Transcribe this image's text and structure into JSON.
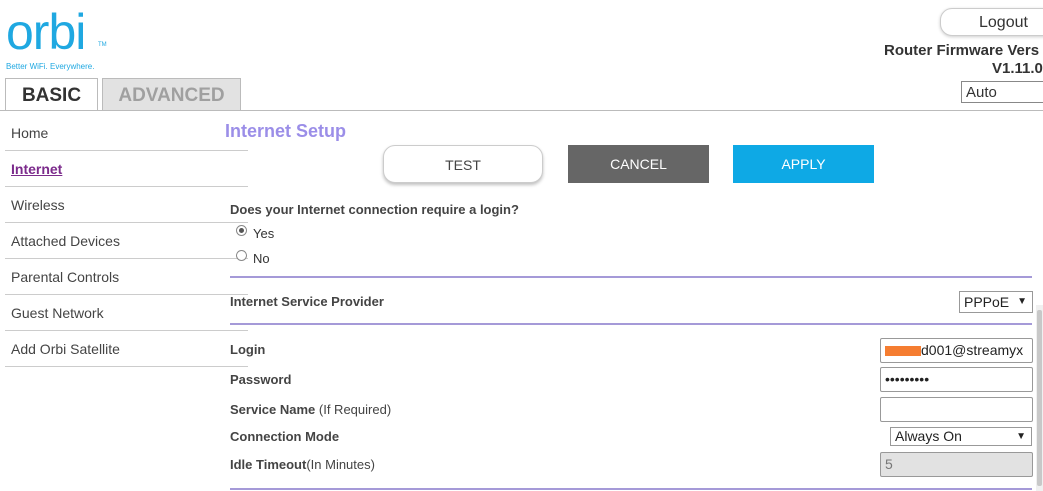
{
  "brand": {
    "logo_text": "orbi",
    "tm": "TM",
    "tagline": "Better WiFi. Everywhere."
  },
  "tabs": [
    {
      "label": "BASIC",
      "active": true
    },
    {
      "label": "ADVANCED",
      "active": false
    }
  ],
  "header": {
    "logout_label": "Logout",
    "firmware_label": "Router Firmware Vers",
    "firmware_version": "V1.11.0",
    "language_value": "Auto"
  },
  "sidebar": {
    "items": [
      {
        "label": "Home"
      },
      {
        "label": "Internet",
        "active": true
      },
      {
        "label": "Wireless"
      },
      {
        "label": "Attached Devices"
      },
      {
        "label": "Parental Controls"
      },
      {
        "label": "Guest Network"
      },
      {
        "label": "Add Orbi Satellite"
      }
    ]
  },
  "main": {
    "title": "Internet Setup",
    "buttons": {
      "test": "TEST",
      "cancel": "CANCEL",
      "apply": "APPLY"
    },
    "login_question": "Does your Internet connection require a login?",
    "options": {
      "yes": "Yes",
      "no": "No",
      "selected": "Yes"
    },
    "isp": {
      "label": "Internet Service Provider",
      "value": "PPPoE"
    },
    "login": {
      "label": "Login",
      "value": "d001@streamyx"
    },
    "password": {
      "label": "Password",
      "value": "•••••••••"
    },
    "service_name": {
      "label": "Service Name",
      "note": " (If Required)",
      "value": ""
    },
    "connection_mode": {
      "label": "Connection Mode",
      "value": "Always On"
    },
    "idle_timeout": {
      "label": "Idle Timeout",
      "note": "(In Minutes)",
      "value": "5"
    }
  },
  "colors": {
    "accent": "#1fa8e1",
    "apply": "#0ea9e5",
    "cancel": "#666666",
    "title": "#9b8ee8",
    "divider": "#a59ad8",
    "active_nav": "#7b2a8b",
    "redaction": "#f57d31"
  }
}
